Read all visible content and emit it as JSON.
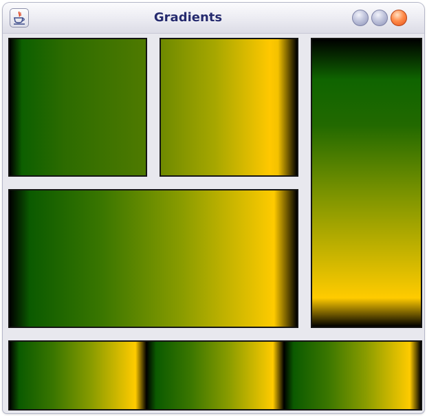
{
  "window": {
    "title": "Gradients",
    "app_icon": "java-coffee-cup-icon",
    "controls": [
      {
        "name": "minimize",
        "icon": "minimize-circle-icon",
        "color": "#b6bad6"
      },
      {
        "name": "maximize",
        "icon": "maximize-circle-icon",
        "color": "#b6bad6"
      },
      {
        "name": "close",
        "icon": "close-circle-icon",
        "color": "#f07a3a"
      }
    ]
  },
  "gradient_colors": {
    "black": "#000000",
    "dark_green": "#0b5a00",
    "olive": "#8a9c00",
    "gold": "#ffcb00"
  },
  "panels": [
    {
      "id": "top-left",
      "direction": "horizontal",
      "colors": [
        "#000000",
        "#0d5f00",
        "#4f7a00"
      ]
    },
    {
      "id": "top-middle",
      "direction": "horizontal",
      "colors": [
        "#6e8a00",
        "#ffc800",
        "#000000"
      ]
    },
    {
      "id": "middle-wide",
      "direction": "horizontal",
      "colors": [
        "#000000",
        "#0b5a00",
        "#ffcb00",
        "#000000"
      ]
    },
    {
      "id": "right-tall",
      "direction": "vertical",
      "colors": [
        "#000000",
        "#0f6400",
        "#ffcb00",
        "#000000"
      ]
    },
    {
      "id": "bottom-strip",
      "direction": "horizontal",
      "repeat": 3,
      "colors": [
        "#000000",
        "#0b5a00",
        "#ffcb00",
        "#000000"
      ]
    }
  ]
}
